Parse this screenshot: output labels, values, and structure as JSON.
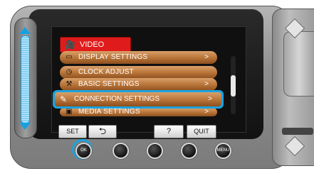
{
  "menu": {
    "header": {
      "icon": "video-camera-icon",
      "label": "VIDEO"
    },
    "items": [
      {
        "icon": "display-icon",
        "label": "DISPLAY SETTINGS",
        "chevron": ">"
      },
      {
        "icon": "clock-icon",
        "label": "CLOCK ADJUST",
        "chevron": ""
      },
      {
        "icon": "wrench-icon",
        "label": "BASIC SETTINGS",
        "chevron": ">"
      },
      {
        "icon": "connection-icon",
        "label": "CONNECTION SETTINGS",
        "chevron": ">",
        "selected": true
      },
      {
        "icon": "media-icon",
        "label": "MEDIA SETTINGS",
        "chevron": ">"
      }
    ],
    "scroll_position_fraction": 0.35
  },
  "soft_buttons": {
    "set": "SET",
    "back_icon": "back-arrow-icon",
    "back": "⮌",
    "help": "?",
    "quit": "QUIT"
  },
  "hardware_buttons": {
    "ok": "OK",
    "menu": "MENU"
  },
  "colors": {
    "header": "#e01b1b",
    "item": "#b77337",
    "selection": "#1aa3e0",
    "slider": "#17a0e0"
  }
}
